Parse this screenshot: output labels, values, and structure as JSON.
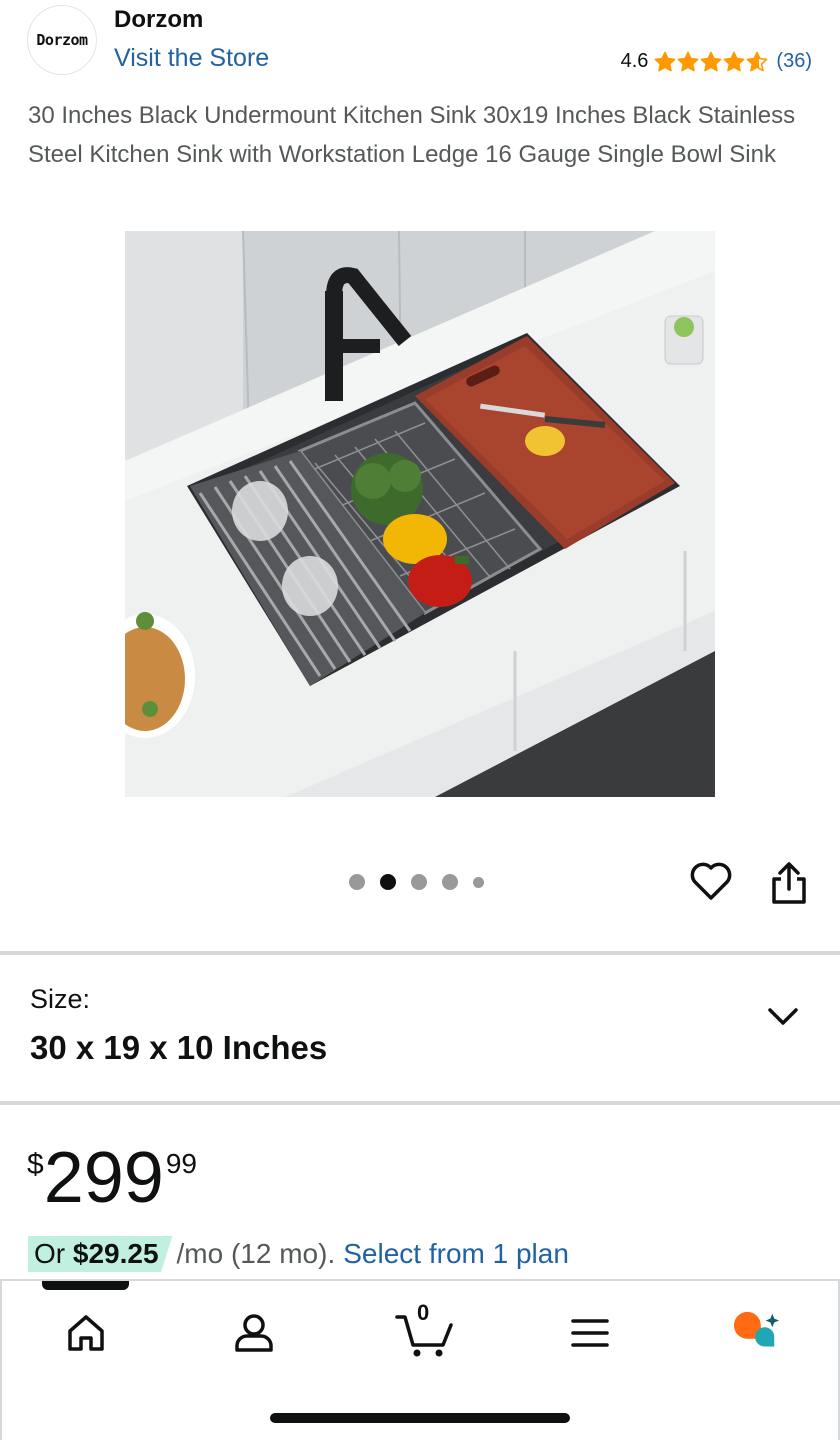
{
  "brand": {
    "logo_text": "Dorzom",
    "name": "Dorzom",
    "visit_store": "Visit the Store"
  },
  "rating": {
    "value": "4.6",
    "stars": 4.6,
    "count": "(36)",
    "star_color": "#ff9900"
  },
  "product": {
    "title": "30 Inches Black Undermount Kitchen Sink 30x19 Inches Black Stainless Steel Kitchen Sink with Workstation Ledge 16 Gauge Single Bowl Sink",
    "image_description": "Black undermount sink with cutting board, drying racks and vegetables on a white countertop"
  },
  "gallery": {
    "total_dots": 5,
    "active_index": 1
  },
  "size": {
    "label": "Size:",
    "value": "30 x 19 x 10 Inches"
  },
  "price": {
    "currency": "$",
    "whole": "299",
    "fraction": "99"
  },
  "installment": {
    "prefix": "Or ",
    "amount": "$29.25",
    "suffix": " /mo (12 mo).",
    "link": "Select from 1 plan",
    "highlight_color": "#c2f0e0"
  },
  "bottom_nav": {
    "items": [
      "home-icon",
      "account-icon",
      "cart-icon",
      "menu-icon",
      "rufus-ai-icon"
    ],
    "cart_count": "0",
    "active_item": "home-icon"
  },
  "colors": {
    "link": "#2162a1",
    "text": "#0f1111",
    "secondary_text": "#565959",
    "ai_orange": "#ff6a13",
    "ai_teal": "#22a6b3"
  }
}
